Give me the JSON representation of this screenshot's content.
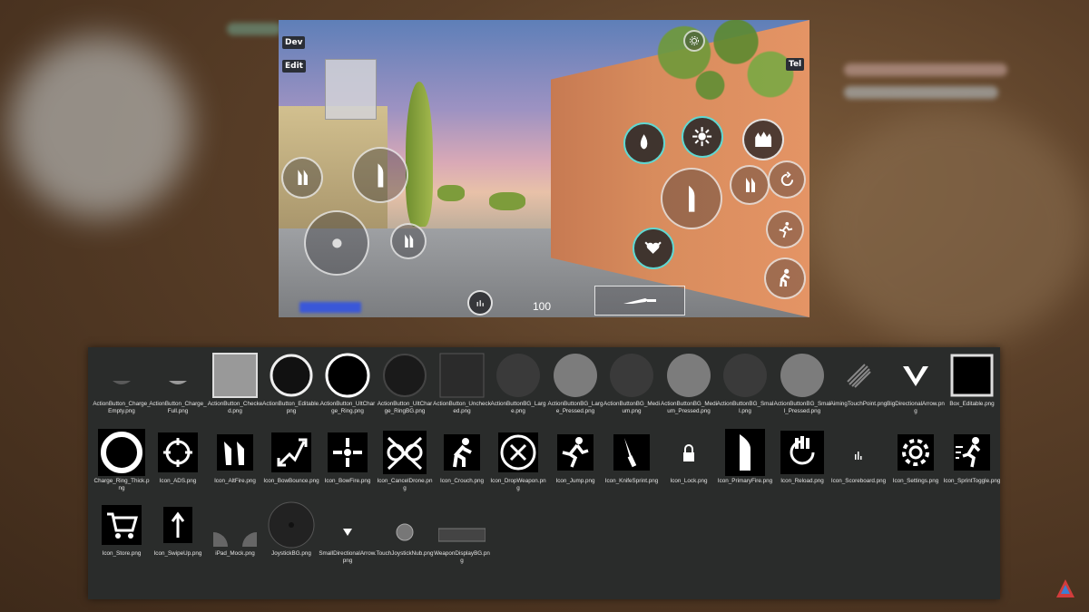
{
  "game": {
    "dev_label": "Dev",
    "edit_label": "Edit",
    "tel_label": "Tel",
    "ammo": "100"
  },
  "assets": [
    {
      "label": "ActionButton_Charge_Empty.png",
      "icon": "charge-empty"
    },
    {
      "label": "ActionButton_Charge_Full.png",
      "icon": "charge-full"
    },
    {
      "label": "ActionButton_Checked.png",
      "icon": "checked"
    },
    {
      "label": "ActionButton_Editable.png",
      "icon": "editable"
    },
    {
      "label": "ActionButton_UltCharge_Ring.png",
      "icon": "ult-ring"
    },
    {
      "label": "ActionButton_UltCharge_RingBG.png",
      "icon": "ult-ringbg"
    },
    {
      "label": "ActionButton_Unchecked.png",
      "icon": "unchecked"
    },
    {
      "label": "ActionButtonBG_Large.png",
      "icon": "bg-large"
    },
    {
      "label": "ActionButtonBG_Large_Pressed.png",
      "icon": "bg-large-pressed"
    },
    {
      "label": "ActionButtonBG_Medium.png",
      "icon": "bg-medium"
    },
    {
      "label": "ActionButtonBG_Medium_Pressed.png",
      "icon": "bg-medium-pressed"
    },
    {
      "label": "ActionButtonBG_Small.png",
      "icon": "bg-small"
    },
    {
      "label": "ActionButtonBG_Small_Pressed.png",
      "icon": "bg-small-pressed"
    },
    {
      "label": "AimingTouchPoint.png",
      "icon": "aiming-touch"
    },
    {
      "label": "BigDirectionalArrow.png",
      "icon": "big-arrow"
    },
    {
      "label": "Box_Editable.png",
      "icon": "box-editable"
    },
    {
      "label": "Charge_Ring_Thick.png",
      "icon": "charge-ring-thick"
    },
    {
      "label": "Icon_ADS.png",
      "icon": "ads"
    },
    {
      "label": "Icon_AltFire.png",
      "icon": "altfire"
    },
    {
      "label": "Icon_BowBounce.png",
      "icon": "bowbounce"
    },
    {
      "label": "Icon_BowFire.png",
      "icon": "bowfire"
    },
    {
      "label": "Icon_CancelDrone.png",
      "icon": "canceldrone"
    },
    {
      "label": "Icon_Crouch.png",
      "icon": "crouch"
    },
    {
      "label": "Icon_DropWeapon.png",
      "icon": "dropweapon"
    },
    {
      "label": "Icon_Jump.png",
      "icon": "jump"
    },
    {
      "label": "Icon_KnifeSprint.png",
      "icon": "knifesprint"
    },
    {
      "label": "Icon_Lock.png",
      "icon": "lock"
    },
    {
      "label": "Icon_PrimaryFire.png",
      "icon": "primaryfire"
    },
    {
      "label": "Icon_Reload.png",
      "icon": "reload"
    },
    {
      "label": "Icon_Scoreboard.png",
      "icon": "scoreboard"
    },
    {
      "label": "Icon_Settings.png",
      "icon": "settings"
    },
    {
      "label": "Icon_SprintToggle.png",
      "icon": "sprinttoggle"
    },
    {
      "label": "Icon_Store.png",
      "icon": "store"
    },
    {
      "label": "Icon_SwipeUp.png",
      "icon": "swipeup"
    },
    {
      "label": "iPad_Mock.png",
      "icon": "ipad-mock"
    },
    {
      "label": "JoystickBG.png",
      "icon": "joystick-bg"
    },
    {
      "label": "SmallDirectionalArrow.png",
      "icon": "small-arrow"
    },
    {
      "label": "TouchJoystickNub.png",
      "icon": "joystick-nub"
    },
    {
      "label": "WeaponDisplayBG.png",
      "icon": "weapon-display-bg"
    }
  ]
}
